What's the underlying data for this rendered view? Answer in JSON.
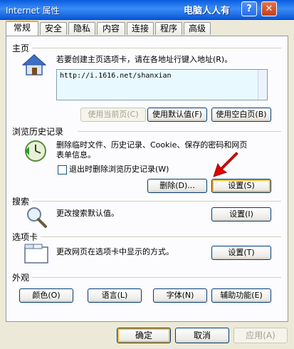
{
  "window": {
    "title": "Internet 属性",
    "watermark": "电脑人人有",
    "help_label": "?",
    "close_label": "✕"
  },
  "tabs": [
    "常规",
    "安全",
    "隐私",
    "内容",
    "连接",
    "程序",
    "高级"
  ],
  "home": {
    "section_label": "主页",
    "description": "若要创建主页选项卡，请在各地址行键入地址(R)。",
    "url": "http://i.1616.net/shanxian",
    "btn_current": "使用当前页(C)",
    "btn_default": "使用默认值(F)",
    "btn_blank": "使用空白页(B)"
  },
  "history": {
    "section_label": "浏览历史记录",
    "description_line1": "删除临时文件、历史记录、Cookie、保存的密码和网页",
    "description_line2": "表单信息。",
    "checkbox_label": "退出时删除浏览历史记录(W)",
    "btn_delete": "删除(D)...",
    "btn_settings": "设置(S)"
  },
  "search": {
    "section_label": "搜索",
    "description": "更改搜索默认值。",
    "btn_settings": "设置(I)"
  },
  "tabs_section": {
    "section_label": "选项卡",
    "description": "更改网页在选项卡中显示的方式。",
    "btn_settings": "设置(T)"
  },
  "appearance": {
    "section_label": "外观",
    "btn_colors": "颜色(O)",
    "btn_languages": "语言(L)",
    "btn_fonts": "字体(N)",
    "btn_accessibility": "辅助功能(E)"
  },
  "footer": {
    "ok": "确定",
    "cancel": "取消",
    "apply": "应用(A)"
  },
  "colors": {
    "accent_tab": "#f5a80f",
    "arrow": "#e00000"
  }
}
